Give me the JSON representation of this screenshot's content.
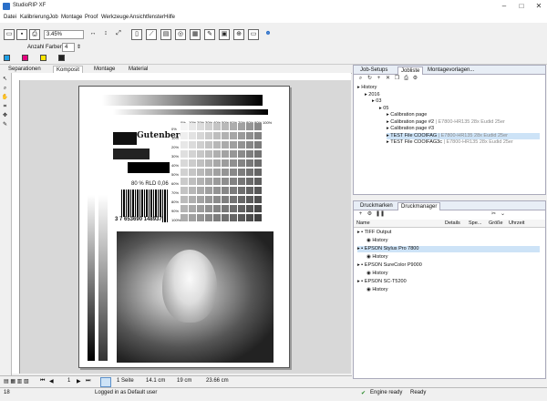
{
  "window": {
    "title": "StudioRIP XF"
  },
  "menu": [
    "Datei",
    "Kalibrierung",
    "Job",
    "Montage",
    "Proof",
    "Werkzeuge",
    "Ansichtfenster",
    "Hilfe"
  ],
  "toolbar": {
    "zoom": "3.45%",
    "colors_label": "Anzahl Farben",
    "colors_count": "4"
  },
  "swatch_colors": [
    "#1ea0e6",
    "#e6007e",
    "#ffe600",
    "#222222"
  ],
  "tabs": [
    "Separationen",
    "Komposit",
    "Montage",
    "Material"
  ],
  "active_tab": 1,
  "page_content": {
    "ink_label": "80 % RLD 0,06",
    "barcode_number": "3 7 653690 148937",
    "logo_text": "Gutenberg",
    "percent_labels": [
      "0%",
      "10%",
      "20%",
      "30%",
      "40%",
      "50%",
      "60%",
      "70%",
      "80%",
      "90%",
      "100%"
    ]
  },
  "status": {
    "page_label": "1",
    "pages": "1 Seite",
    "width": "14.1 cm",
    "height": "19 cm",
    "total": "23.66 cm"
  },
  "bottom": {
    "left_value": "18",
    "user": "Logged in as Default user",
    "engine": "Engine ready",
    "ready": "Ready"
  },
  "job_panel": {
    "tabs": [
      "Job-Setups",
      "Jobliste",
      "Montagevorlagen..."
    ],
    "active": 1,
    "tree": [
      {
        "indent": 0,
        "label": "History",
        "muted": ""
      },
      {
        "indent": 1,
        "label": "2016",
        "muted": ""
      },
      {
        "indent": 2,
        "label": "03",
        "muted": ""
      },
      {
        "indent": 3,
        "label": "05",
        "muted": ""
      },
      {
        "indent": 4,
        "label": "Calibration page",
        "muted": ""
      },
      {
        "indent": 4,
        "label": "Calibration page #2",
        "muted": "| E7800-HR135 28x Eudid 25er"
      },
      {
        "indent": 4,
        "label": "Calibration page #3",
        "muted": ""
      },
      {
        "indent": 4,
        "label": "TEST File COOIFAG",
        "muted": "| E7800-HR135 28x Eudid 25er",
        "selected": true
      },
      {
        "indent": 4,
        "label": "TEST File COOIFAG3c",
        "muted": "| E7800-HR135 28x Eudid 25er"
      }
    ]
  },
  "printer_panel": {
    "tabs": [
      "Druckmarken",
      "Druckmanager"
    ],
    "active": 1,
    "headers": [
      "Name",
      "Details",
      "Spe...",
      "Größe",
      "Uhrzeit"
    ],
    "rows": [
      {
        "indent": 0,
        "label": "TIFF Output"
      },
      {
        "indent": 1,
        "label": "History"
      },
      {
        "indent": 0,
        "label": "EPSON Stylus Pro 7800",
        "selected": true
      },
      {
        "indent": 1,
        "label": "History"
      },
      {
        "indent": 0,
        "label": "EPSON SureColor P9000"
      },
      {
        "indent": 1,
        "label": "History"
      },
      {
        "indent": 0,
        "label": "EPSON SC-T5200"
      },
      {
        "indent": 1,
        "label": "History"
      }
    ]
  }
}
